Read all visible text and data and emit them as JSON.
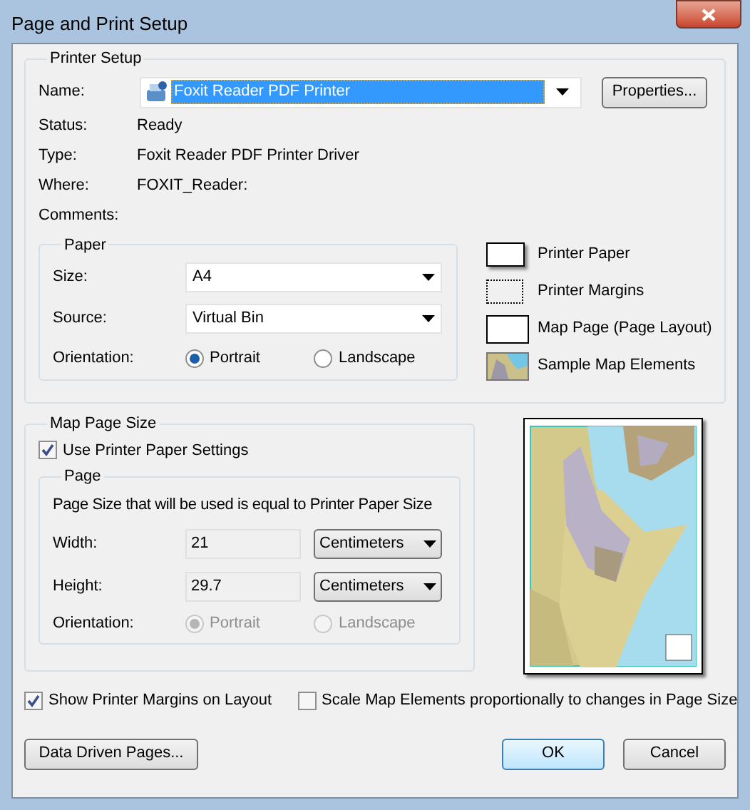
{
  "window": {
    "title": "Page and Print Setup"
  },
  "printer_setup": {
    "title": "Printer Setup",
    "name_label": "Name:",
    "name_value": "Foxit Reader PDF Printer",
    "properties_button": "Properties...",
    "info": [
      {
        "label": "Status:",
        "value": "Ready"
      },
      {
        "label": "Type:",
        "value": "Foxit Reader PDF Printer Driver"
      },
      {
        "label": "Where:",
        "value": "FOXIT_Reader:"
      },
      {
        "label": "Comments:"
      }
    ]
  },
  "paper": {
    "title": "Paper",
    "fields": [
      {
        "label": "Size:",
        "value": "A4"
      },
      {
        "label": "Source:",
        "value": "Virtual Bin"
      }
    ],
    "orientation_label": "Orientation:",
    "orientation": [
      {
        "label": "Portrait",
        "selected": true
      },
      {
        "label": "Landscape",
        "selected": false
      }
    ]
  },
  "legend": [
    {
      "kind": "paper",
      "label": "Printer Paper"
    },
    {
      "kind": "margins",
      "label": "Printer Margins"
    },
    {
      "kind": "page",
      "label": "Map Page (Page Layout)"
    },
    {
      "kind": "sample",
      "label": "Sample Map Elements"
    }
  ],
  "map_page_size": {
    "title": "Map Page Size",
    "use_printer_settings": {
      "label": "Use Printer Paper Settings",
      "checked": true
    },
    "page": {
      "title": "Page",
      "disabled": true,
      "note": "Page Size that will be used is equal to Printer Paper Size",
      "fields": [
        {
          "label": "Width:",
          "value": "21",
          "unit": "Centimeters"
        },
        {
          "label": "Height:",
          "value": "29.7",
          "unit": "Centimeters"
        }
      ],
      "orientation_label": "Orientation:",
      "orientation": [
        {
          "label": "Portrait",
          "selected": true
        },
        {
          "label": "Landscape",
          "selected": false
        }
      ]
    }
  },
  "options": [
    {
      "label": "Show Printer Margins on Layout",
      "checked": true
    },
    {
      "label": "Scale Map Elements proportionally to changes in Page Size",
      "checked": false
    }
  ],
  "buttons": [
    {
      "label": "Data Driven Pages...",
      "default": false
    },
    {
      "label": "OK",
      "default": true
    },
    {
      "label": "Cancel",
      "default": false
    }
  ]
}
